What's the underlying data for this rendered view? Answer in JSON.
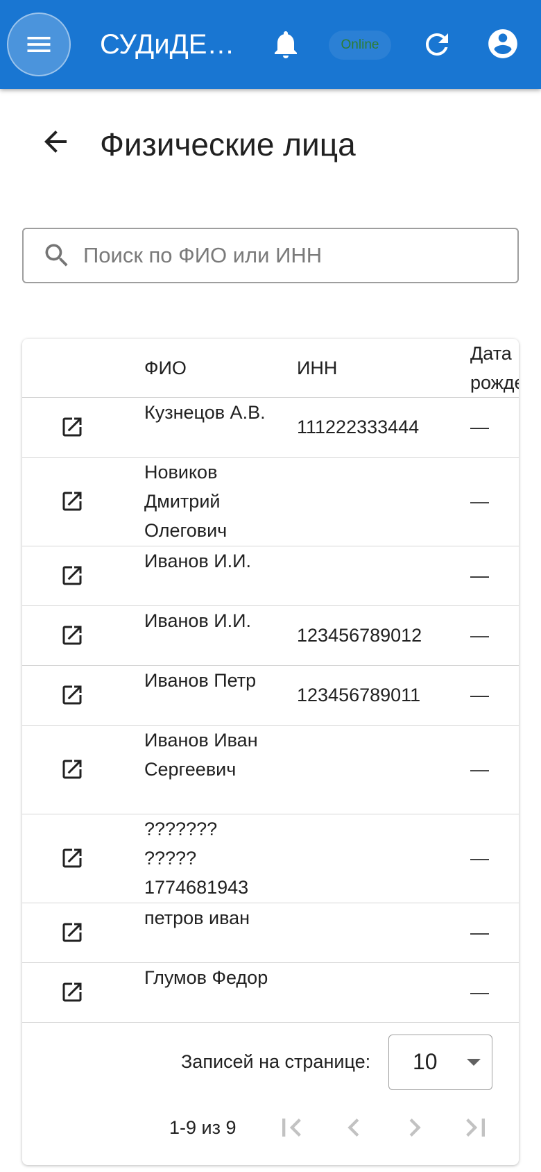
{
  "appbar": {
    "title": "СУДиДЕ…",
    "status": "Online",
    "colors": {
      "primary": "#1976d2",
      "status_text": "#2e7d32"
    },
    "icons": [
      "menu-icon",
      "bell-icon",
      "refresh-icon",
      "account-circle-icon"
    ]
  },
  "page": {
    "title": "Физические лица",
    "back_icon": "arrow-back-icon"
  },
  "search": {
    "placeholder": "Поиск по ФИО или ИНН",
    "value": "",
    "icon": "search-icon"
  },
  "table": {
    "headers": {
      "fio": "ФИО",
      "inn": "ИНН",
      "dob": "Дата рожде"
    },
    "row_icon": "open-in-new-icon",
    "rows": [
      {
        "fio": "Кузнецов А.В.",
        "inn": "111222333444",
        "dob": "—"
      },
      {
        "fio": "Новиков Дмитрий Олегович",
        "inn": "",
        "dob": "—"
      },
      {
        "fio": "Иванов И.И.",
        "inn": "",
        "dob": "—"
      },
      {
        "fio": "Иванов И.И.",
        "inn": "123456789012",
        "dob": "—"
      },
      {
        "fio": "Иванов Петр",
        "inn": "123456789011",
        "dob": "—"
      },
      {
        "fio": "Иванов Иван Сергеевич",
        "inn": "",
        "dob": "—"
      },
      {
        "fio": "??????? ????? 1774681943",
        "inn": "",
        "dob": "—"
      },
      {
        "fio": "петров иван",
        "inn": "",
        "dob": "—"
      },
      {
        "fio": "Глумов Федор",
        "inn": "",
        "dob": "—"
      }
    ]
  },
  "pagination": {
    "rows_per_page_label": "Записей на странице:",
    "rows_per_page": "10",
    "range": "1-9 из 9",
    "icons": [
      "first-page-icon",
      "previous-page-icon",
      "next-page-icon",
      "last-page-icon"
    ]
  }
}
